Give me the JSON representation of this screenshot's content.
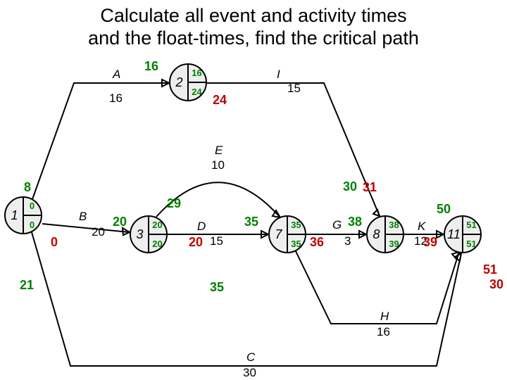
{
  "title_line1": "Calculate all event and activity times",
  "title_line2": "and the float-times, find the critical path",
  "nodes": {
    "n1": {
      "id": "1",
      "et": "0",
      "lt": "0"
    },
    "n2": {
      "id": "2",
      "et": "16",
      "lt": "24"
    },
    "n3": {
      "id": "3",
      "et": "20",
      "lt": "20"
    },
    "n7": {
      "id": "7",
      "et": "35",
      "lt": "35"
    },
    "n8": {
      "id": "8",
      "et": "38",
      "lt": "39"
    },
    "n11": {
      "id": "11",
      "et": "51",
      "lt": "51"
    }
  },
  "edges": {
    "A": {
      "label": "A",
      "dur": "16"
    },
    "B": {
      "label": "B",
      "dur": "20"
    },
    "C": {
      "label": "C",
      "dur": "30"
    },
    "D": {
      "label": "D",
      "dur": "15"
    },
    "E": {
      "label": "E",
      "dur": "10"
    },
    "G": {
      "label": "G",
      "dur": "3"
    },
    "H": {
      "label": "H",
      "dur": "16"
    },
    "I": {
      "label": "I",
      "dur": "15"
    },
    "K": {
      "label": "K",
      "dur": "12"
    }
  },
  "ann": {
    "a16a": "16",
    "a24r": "24",
    "a8": "8",
    "a29": "29",
    "a30": "30",
    "a31": "31",
    "a20g": "20",
    "a0r": "0",
    "a20r": "20",
    "a35g": "35",
    "a36r": "36",
    "a38g": "38",
    "a39r": "39",
    "a21": "21",
    "a35c": "35",
    "a50": "50",
    "a51r": "51",
    "a30r": "30"
  }
}
